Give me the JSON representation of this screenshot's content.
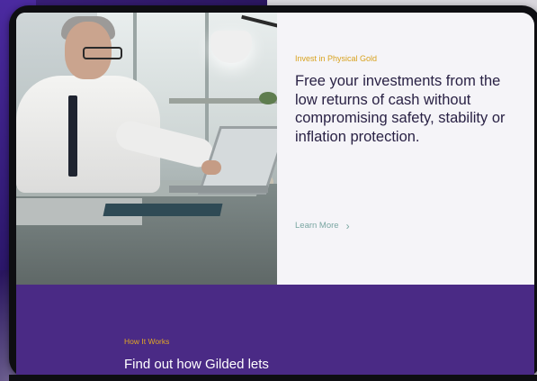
{
  "hero": {
    "eyebrow": "Invest in Physical Gold",
    "headline": "Free your investments from the low returns of cash without compromising safety, stability or inflation protection.",
    "cta_label": "Learn More",
    "cta_icon": "chevron-right-icon",
    "photo_subject": "person-at-laptop-photo"
  },
  "how_it_works": {
    "eyebrow": "How It Works",
    "title": "Find out how Gilded lets"
  },
  "colors": {
    "gold_accent": "#d8a21f",
    "purple_band": "#4a2a85",
    "teal_link": "#7aa6a2",
    "headline_text": "#2a2245"
  }
}
